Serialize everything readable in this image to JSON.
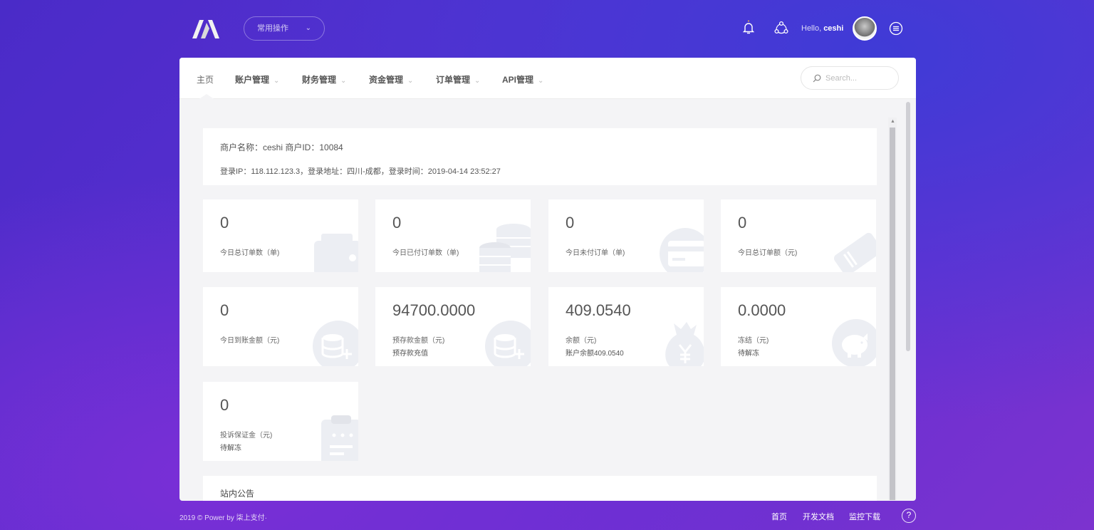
{
  "header": {
    "quick_menu_label": "常用操作",
    "hello_prefix": "Hello, ",
    "username": "ceshi"
  },
  "nav": {
    "home": "主页",
    "items": [
      {
        "label": "账户管理"
      },
      {
        "label": "财务管理"
      },
      {
        "label": "资金管理"
      },
      {
        "label": "订单管理"
      },
      {
        "label": "API管理"
      }
    ],
    "search_placeholder": "Search..."
  },
  "merchant": {
    "line1": "商户名称：ceshi  商户ID：10084",
    "line2": "登录IP：118.112.123.3，登录地址：四川-成都，登录时间：2019-04-14 23:52:27"
  },
  "stats": [
    {
      "value": "0",
      "label": "今日总订单数（单)",
      "sub": "",
      "icon": "wallet-icon"
    },
    {
      "value": "0",
      "label": "今日已付订单数（单)",
      "sub": "",
      "icon": "coins-icon"
    },
    {
      "value": "0",
      "label": "今日未付订单（单)",
      "sub": "",
      "icon": "credit-card-icon"
    },
    {
      "value": "0",
      "label": "今日总订单额（元)",
      "sub": "",
      "icon": "ticket-icon"
    },
    {
      "value": "0",
      "label": "今日到账金额（元)",
      "sub": "",
      "icon": "coin-add-icon"
    },
    {
      "value": "94700.0000",
      "label": "预存款金额（元)",
      "sub": "预存款充值",
      "icon": "coin-add-icon"
    },
    {
      "value": "409.0540",
      "label": "余额（元)",
      "sub": "账户余额409.0540",
      "icon": "money-bag-icon"
    },
    {
      "value": "0.0000",
      "label": "冻结（元)",
      "sub": "待解冻",
      "icon": "piggy-bank-icon"
    },
    {
      "value": "0",
      "label": "投诉保证金（元)",
      "sub": "待解冻",
      "icon": "clipboard-icon"
    }
  ],
  "notice_title": "站内公告",
  "footer": {
    "copyright": "2019 © Power by 柒上支付·",
    "links": [
      "首页",
      "开发文档",
      "监控下载"
    ],
    "help": "?"
  },
  "colors": {
    "background_gradient": [
      "#4a2bc8",
      "#7c33cf"
    ],
    "panel_bg": "#f4f4f6",
    "card_bg": "#ffffff",
    "icon_watermark": "#eceef3"
  }
}
